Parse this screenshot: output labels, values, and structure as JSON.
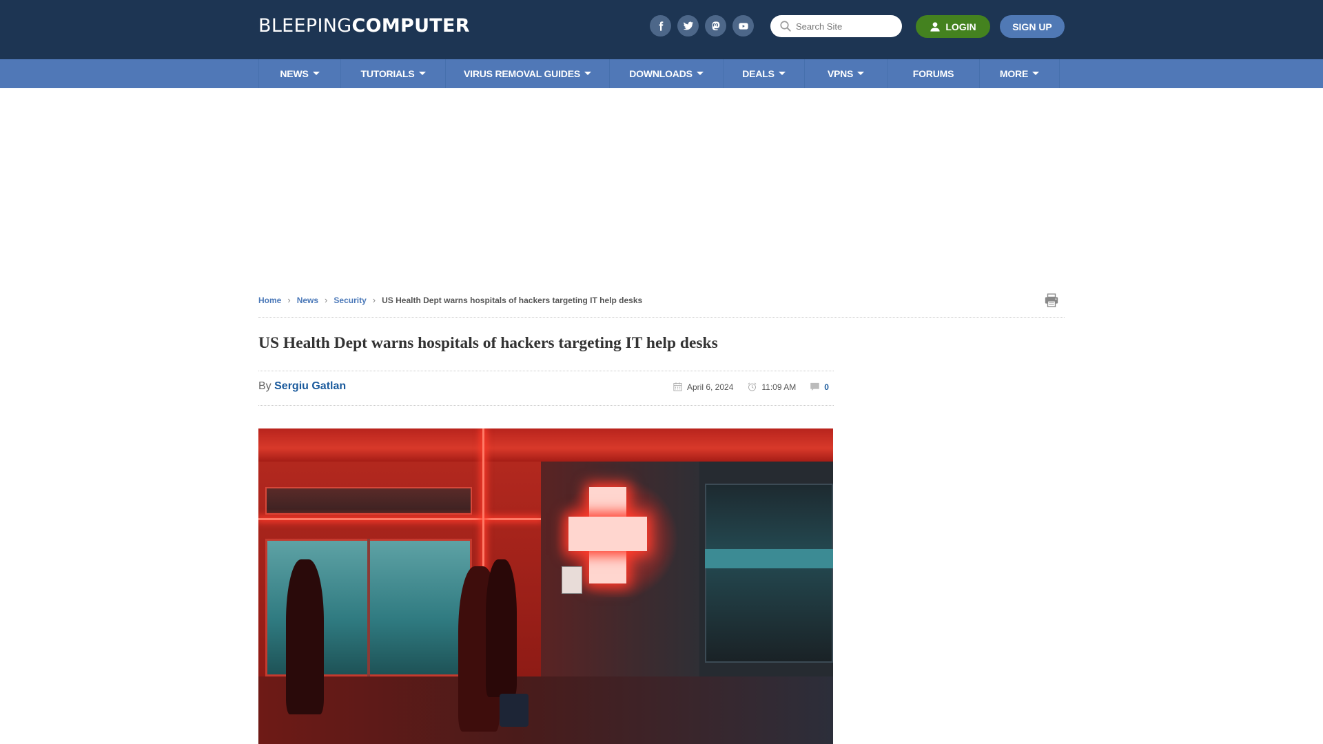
{
  "header": {
    "logo_light": "BLEEPING",
    "logo_bold": "COMPUTER",
    "social": [
      {
        "name": "facebook",
        "icon": "facebook-icon"
      },
      {
        "name": "twitter",
        "icon": "twitter-icon"
      },
      {
        "name": "mastodon",
        "icon": "mastodon-icon"
      },
      {
        "name": "youtube",
        "icon": "youtube-icon"
      }
    ],
    "search_placeholder": "Search Site",
    "search_value": "",
    "login_label": "LOGIN",
    "signup_label": "SIGN UP"
  },
  "nav": {
    "items": [
      {
        "label": "NEWS",
        "dropdown": true
      },
      {
        "label": "TUTORIALS",
        "dropdown": true
      },
      {
        "label": "VIRUS REMOVAL GUIDES",
        "dropdown": true
      },
      {
        "label": "DOWNLOADS",
        "dropdown": true
      },
      {
        "label": "DEALS",
        "dropdown": true
      },
      {
        "label": "VPNS",
        "dropdown": true
      },
      {
        "label": "FORUMS",
        "dropdown": false
      },
      {
        "label": "MORE",
        "dropdown": true
      }
    ]
  },
  "breadcrumb": {
    "items": [
      "Home",
      "News",
      "Security"
    ],
    "current": "US Health Dept warns hospitals of hackers targeting IT help desks"
  },
  "article": {
    "title": "US Health Dept warns hospitals of hackers targeting IT help desks",
    "by_label": "By",
    "author": "Sergiu Gatlan",
    "date": "April 6, 2024",
    "time": "11:09 AM",
    "comments": "0",
    "image_alt": "Hospital entrance with red neon medical cross at night"
  },
  "colors": {
    "header_bg": "#1d3553",
    "nav_bg": "#5078b7",
    "login_bg": "#44821f",
    "signup_bg": "#5079b5",
    "link": "#4a78b8",
    "author": "#1a5a9c"
  }
}
